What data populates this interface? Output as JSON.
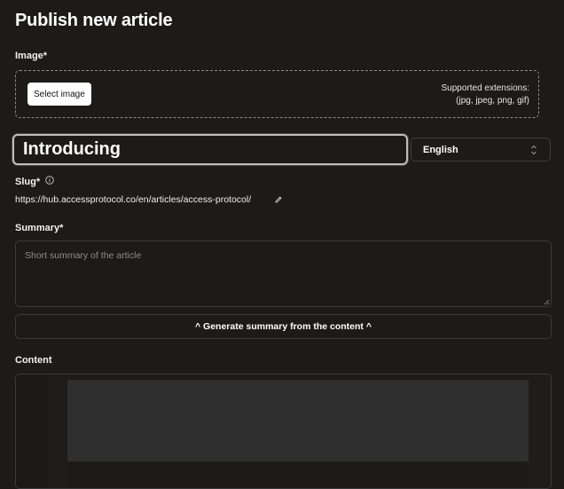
{
  "page": {
    "title": "Publish new article"
  },
  "image": {
    "label": "Image*",
    "select_button": "Select image",
    "supported_line1": "Supported extensions:",
    "supported_line2": "(jpg, jpeg, png, gif)"
  },
  "title_input": {
    "value": "Introducing"
  },
  "language": {
    "selected": "English",
    "icon": "chevron-up-down-icon"
  },
  "slug": {
    "label": "Slug*",
    "info_icon": "info-icon",
    "url": "https://hub.accessprotocol.co/en/articles/access-protocol/",
    "edit_icon": "pencil-icon"
  },
  "summary": {
    "label": "Summary*",
    "placeholder": "Short summary of the article",
    "value": ""
  },
  "generate_button": "^ Generate summary from the content ^",
  "content": {
    "label": "Content"
  },
  "colors": {
    "background": "#1c1b1a",
    "border": "#3a3a3a",
    "focus_border": "#bdbdbd",
    "button_bg": "#ffffff"
  }
}
